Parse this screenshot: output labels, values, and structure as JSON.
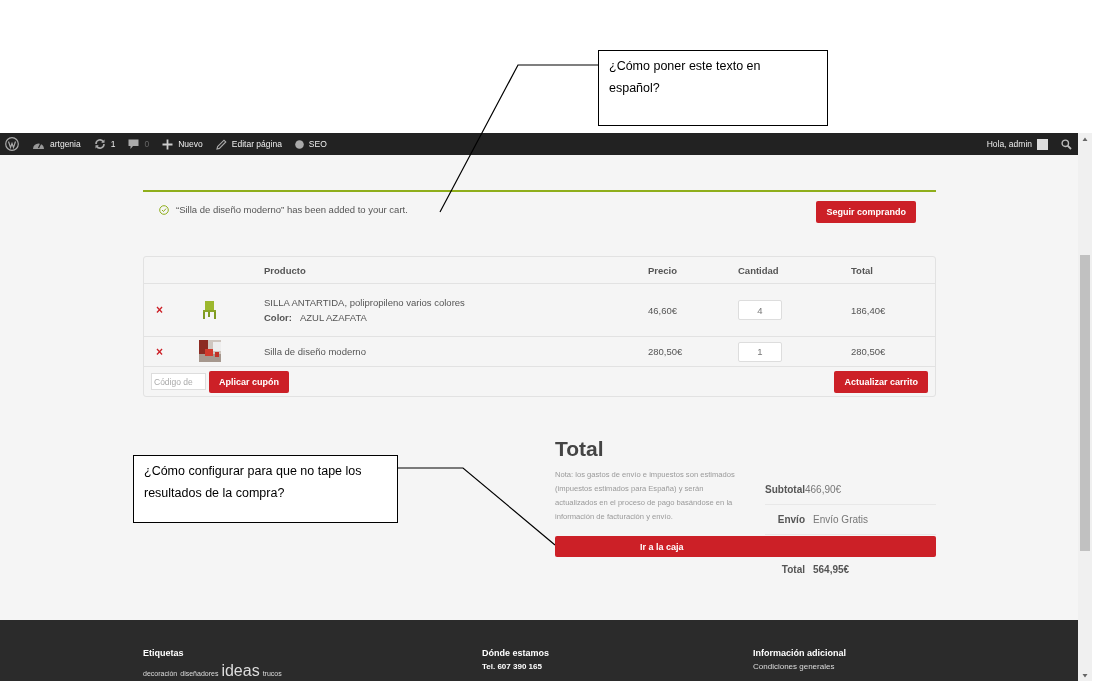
{
  "admin_bar": {
    "items": [
      {
        "kind": "logo"
      },
      {
        "kind": "site",
        "label": "artgenia"
      },
      {
        "kind": "updates",
        "label": "1"
      },
      {
        "kind": "comments",
        "label": "0"
      },
      {
        "kind": "new",
        "label": "Nuevo"
      },
      {
        "kind": "edit",
        "label": "Editar página"
      },
      {
        "kind": "seo",
        "label": "SEO"
      }
    ],
    "greeting": "Hola, admin"
  },
  "notice": {
    "message": "“Silla de diseño moderno” has been added to your cart.",
    "button": "Seguir comprando"
  },
  "cart": {
    "columns": [
      "Producto",
      "Precio",
      "Cantidad",
      "Total"
    ],
    "rows": [
      {
        "remove": "×",
        "name": "SILLA ANTARTIDA, polipropileno varios colores",
        "attribute_label": "Color:",
        "attribute_value": "AZUL AZAFATA",
        "price": "46,60€",
        "quantity": "4",
        "total": "186,40€"
      },
      {
        "remove": "×",
        "name": "Silla de diseño moderno",
        "price": "280,50€",
        "quantity": "1",
        "total": "280,50€"
      }
    ],
    "coupon_placeholder": "Código de",
    "apply_button": "Aplicar cupón",
    "update_button": "Actualizar carrito"
  },
  "totals": {
    "title": "Total",
    "note": "Nota: los gastos de envío e impuestos son estimados (impuestos estimados para España) y serán actualizados en el proceso de pago basándose en la información de facturación y envío.",
    "rows": [
      {
        "kind": "subtotal",
        "label": "Subtotal",
        "value": "466,90€"
      },
      {
        "kind": "shipping",
        "label": "Envío",
        "value": "Envío Gratis"
      },
      {
        "kind": "total",
        "label": "Total",
        "value": "564,95€"
      }
    ],
    "checkout_button": "Ir a la caja"
  },
  "footer": {
    "columns": [
      {
        "title": "Etiquetas",
        "tags": [
          {
            "label": "decoración",
            "kind": "small"
          },
          {
            "label": "diseñadores",
            "kind": "small"
          },
          {
            "label": "ideas",
            "kind": "large"
          },
          {
            "label": "trucos",
            "kind": "small"
          }
        ]
      },
      {
        "title": "Dónde estamos",
        "lines": [
          "Tel. 607 390 165"
        ]
      },
      {
        "title": "Información adicional",
        "lines": [
          "Condiciones generales"
        ]
      }
    ]
  },
  "callouts": [
    {
      "text": "¿Cómo poner este texto en español?"
    },
    {
      "text": "¿Cómo configurar para que no tape los resultados de la compra?"
    }
  ]
}
